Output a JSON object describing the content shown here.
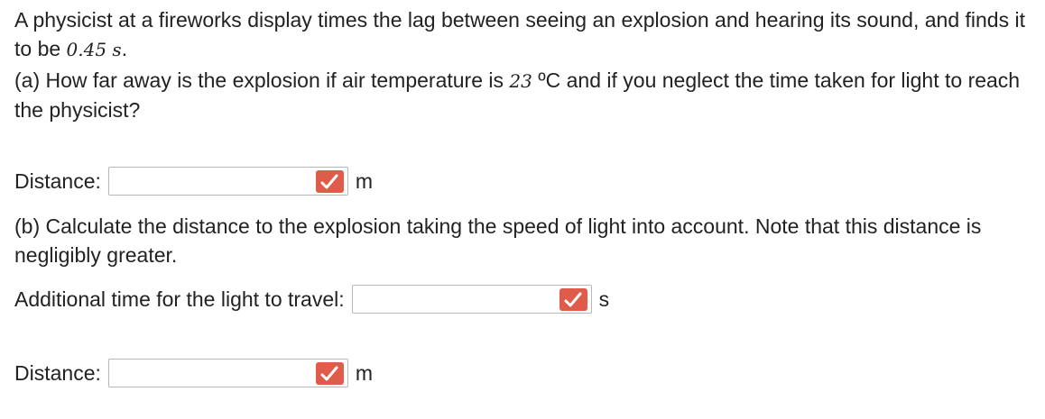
{
  "question": {
    "intro_before": "A physicist at a fireworks display times the lag between seeing an explosion and hearing its sound, and finds it to be ",
    "intro_value": "0.45 s",
    "intro_after": ".",
    "part_a_before": "(a) How far away is the explosion if air temperature is ",
    "part_a_temp": "23",
    "part_a_after": " ºC and if you neglect the time taken for light to reach the physicist?",
    "part_b": "(b) Calculate the distance to the explosion taking the speed of light into account. Note that this distance is negligibly greater."
  },
  "answers": {
    "distance_a": {
      "label": "Distance:",
      "value": "",
      "unit": "m"
    },
    "light_time": {
      "label": "Additional time for the light to travel:",
      "value": "",
      "unit": "s"
    },
    "distance_b": {
      "label": "Distance:",
      "value": "",
      "unit": "m"
    }
  },
  "colors": {
    "check_badge": "#e05c4a",
    "input_border": "#b7b7b7",
    "text": "#222222"
  },
  "icons": {
    "check": "check-icon"
  }
}
